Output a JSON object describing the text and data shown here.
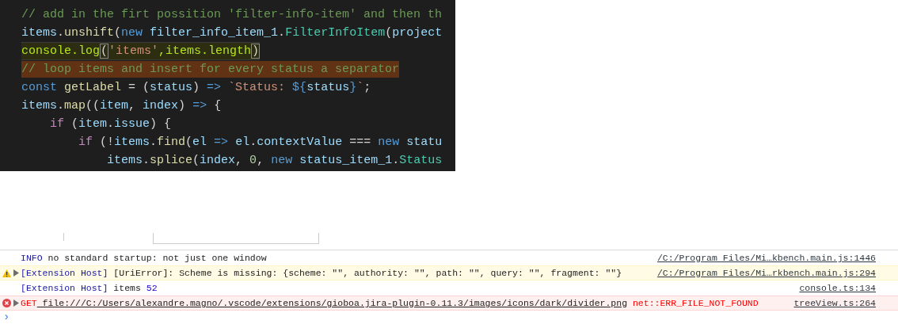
{
  "editor": {
    "lines": [
      {
        "current": false,
        "selected": false,
        "tokens": [
          {
            "kind": "comment",
            "text": "// add in the firt possition 'filter-info-item' and then th"
          }
        ]
      },
      {
        "current": false,
        "selected": false,
        "tokens": [
          {
            "kind": "var",
            "text": "items"
          },
          {
            "kind": "plain",
            "text": "."
          },
          {
            "kind": "fn",
            "text": "unshift"
          },
          {
            "kind": "plain",
            "text": "("
          },
          {
            "kind": "keyword",
            "text": "new "
          },
          {
            "kind": "var",
            "text": "filter_info_item_1"
          },
          {
            "kind": "plain",
            "text": "."
          },
          {
            "kind": "class",
            "text": "FilterInfoItem"
          },
          {
            "kind": "plain",
            "text": "("
          },
          {
            "kind": "var",
            "text": "project"
          }
        ]
      },
      {
        "current": true,
        "selected": false,
        "tokens": [
          {
            "kind": "call",
            "text": "console.log"
          },
          {
            "kind": "bracket",
            "text": "("
          },
          {
            "kind": "string",
            "text": "'items'"
          },
          {
            "kind": "call",
            "text": ",items.length"
          },
          {
            "kind": "bracket",
            "text": ")"
          }
        ]
      },
      {
        "current": false,
        "selected": true,
        "tokens": [
          {
            "kind": "comment",
            "text": "// loop items and insert for every status a separator"
          }
        ]
      },
      {
        "current": false,
        "selected": false,
        "tokens": [
          {
            "kind": "keyword",
            "text": "const "
          },
          {
            "kind": "fn",
            "text": "getLabel"
          },
          {
            "kind": "plain",
            "text": " = ("
          },
          {
            "kind": "var",
            "text": "status"
          },
          {
            "kind": "plain",
            "text": ") "
          },
          {
            "kind": "keyword",
            "text": "=> "
          },
          {
            "kind": "string",
            "text": "`Status: "
          },
          {
            "kind": "keyword",
            "text": "${"
          },
          {
            "kind": "var",
            "text": "status"
          },
          {
            "kind": "keyword",
            "text": "}"
          },
          {
            "kind": "string",
            "text": "`"
          },
          {
            "kind": "plain",
            "text": ";"
          }
        ]
      },
      {
        "current": false,
        "selected": false,
        "tokens": [
          {
            "kind": "var",
            "text": "items"
          },
          {
            "kind": "plain",
            "text": "."
          },
          {
            "kind": "fn",
            "text": "map"
          },
          {
            "kind": "plain",
            "text": "(("
          },
          {
            "kind": "var",
            "text": "item"
          },
          {
            "kind": "plain",
            "text": ", "
          },
          {
            "kind": "var",
            "text": "index"
          },
          {
            "kind": "plain",
            "text": ") "
          },
          {
            "kind": "keyword",
            "text": "=>"
          },
          {
            "kind": "plain",
            "text": " {"
          }
        ]
      },
      {
        "current": false,
        "selected": false,
        "tokens": [
          {
            "kind": "control",
            "text": "    if"
          },
          {
            "kind": "plain",
            "text": " ("
          },
          {
            "kind": "var",
            "text": "item"
          },
          {
            "kind": "plain",
            "text": "."
          },
          {
            "kind": "var",
            "text": "issue"
          },
          {
            "kind": "plain",
            "text": ") {"
          }
        ]
      },
      {
        "current": false,
        "selected": false,
        "tokens": [
          {
            "kind": "control",
            "text": "        if"
          },
          {
            "kind": "plain",
            "text": " (!"
          },
          {
            "kind": "var",
            "text": "items"
          },
          {
            "kind": "plain",
            "text": "."
          },
          {
            "kind": "fn",
            "text": "find"
          },
          {
            "kind": "plain",
            "text": "("
          },
          {
            "kind": "var",
            "text": "el "
          },
          {
            "kind": "keyword",
            "text": "=> "
          },
          {
            "kind": "var",
            "text": "el"
          },
          {
            "kind": "plain",
            "text": "."
          },
          {
            "kind": "var",
            "text": "contextValue"
          },
          {
            "kind": "plain",
            "text": " === "
          },
          {
            "kind": "keyword",
            "text": "new "
          },
          {
            "kind": "var",
            "text": "statu"
          }
        ]
      },
      {
        "current": false,
        "selected": false,
        "tokens": [
          {
            "kind": "var",
            "text": "            items"
          },
          {
            "kind": "plain",
            "text": "."
          },
          {
            "kind": "fn",
            "text": "splice"
          },
          {
            "kind": "plain",
            "text": "("
          },
          {
            "kind": "var",
            "text": "index"
          },
          {
            "kind": "plain",
            "text": ", "
          },
          {
            "kind": "number",
            "text": "0"
          },
          {
            "kind": "plain",
            "text": ", "
          },
          {
            "kind": "keyword",
            "text": "new "
          },
          {
            "kind": "var",
            "text": "status_item_1"
          },
          {
            "kind": "plain",
            "text": "."
          },
          {
            "kind": "class",
            "text": "Status"
          }
        ]
      }
    ]
  },
  "console": {
    "messages": [
      {
        "kind": "info",
        "expandable": false,
        "parts": [
          {
            "kind": "tag",
            "text": "INFO"
          },
          {
            "kind": "text",
            "text": " no standard startup: not just one window"
          }
        ],
        "source": "/C:/Program Files/Mi…kbench.main.js:1446"
      },
      {
        "kind": "warning",
        "expandable": true,
        "parts": [
          {
            "kind": "tag",
            "text": "[Extension Host]"
          },
          {
            "kind": "text",
            "text": " [UriError]: Scheme is missing: {scheme: \"\", authority: \"\", path: \"\", query: \"\", fragment: \"\"}"
          }
        ],
        "source": "/C:/Program Files/Mi…rkbench.main.js:294"
      },
      {
        "kind": "log",
        "expandable": false,
        "parts": [
          {
            "kind": "tag",
            "text": "[Extension Host]"
          },
          {
            "kind": "text",
            "text": " items "
          },
          {
            "kind": "number",
            "text": "52"
          }
        ],
        "source": "console.ts:134"
      },
      {
        "kind": "error",
        "expandable": true,
        "parts": [
          {
            "kind": "method",
            "text": "GET"
          },
          {
            "kind": "link",
            "text": " file:///C:/Users/alexandre.magno/.vscode/extensions/gioboa.jira-plugin-0.11.3/images/icons/dark/divider.png"
          },
          {
            "kind": "error",
            "text": " net::ERR_FILE_NOT_FOUND"
          }
        ],
        "source": "treeView.ts:264"
      }
    ],
    "prompt": "›"
  }
}
